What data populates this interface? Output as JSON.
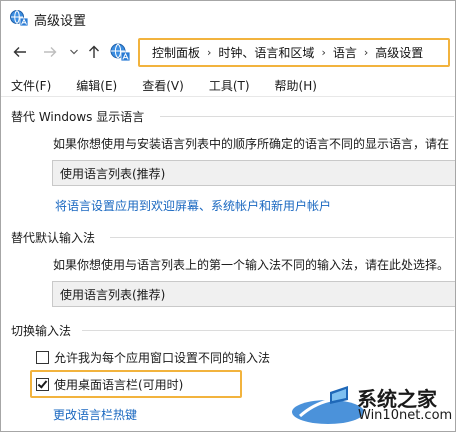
{
  "window": {
    "title": "高级设置"
  },
  "nav": {
    "back_icon": "arrow-left",
    "forward_icon": "arrow-right",
    "history_icon": "chevron-down",
    "up_icon": "arrow-up"
  },
  "breadcrumb": [
    "控制面板",
    "时钟、语言和区域",
    "语言",
    "高级设置"
  ],
  "breadcrumb_separator": "›",
  "menu": [
    "文件(F)",
    "编辑(E)",
    "查看(V)",
    "工具(T)",
    "帮助(H)"
  ],
  "display_language": {
    "heading": "替代 Windows 显示语言",
    "description": "如果你想使用与安装语言列表中的顺序所确定的语言不同的显示语言，请在",
    "selected": "使用语言列表(推荐)",
    "link": "将语言设置应用到欢迎屏幕、系统帐户和新用户帐户"
  },
  "default_input": {
    "heading": "替代默认输入法",
    "description": "如果你想使用与语言列表上的第一个输入法不同的输入法，请在此处选择。",
    "selected": "使用语言列表(推荐)"
  },
  "switch_input": {
    "heading": "切换输入法",
    "option1": "允许我为每个应用窗口设置不同的输入法",
    "option1_checked": false,
    "option2": "使用桌面语言栏(可用时)",
    "option2_checked": true,
    "link": "更改语言栏热键"
  },
  "watermark": {
    "main": "系统之家",
    "sub": "Win10net.com"
  },
  "colors": {
    "highlight": "#f2b33d",
    "link": "#1a68c0",
    "dropdown_bg": "#f0f0f0"
  }
}
